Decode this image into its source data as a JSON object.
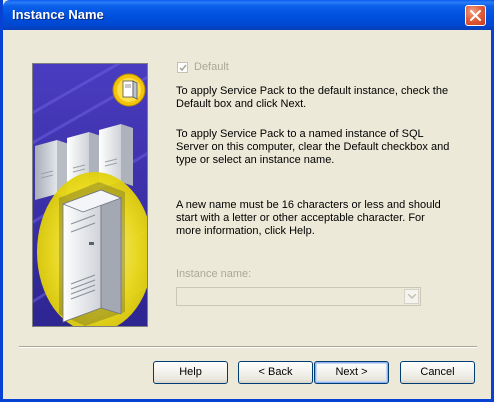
{
  "window": {
    "title": "Instance Name"
  },
  "default_checkbox": {
    "label": "Default",
    "checked": true,
    "disabled": true
  },
  "instructions": {
    "para1": "To apply Service Pack to the default instance,  check the Default box and click Next.",
    "para2": "To apply Service Pack to a named instance of SQL Server on this computer, clear the Default checkbox and type or select an instance name.",
    "para3": "A new name must be 16 characters or less and should start with a letter or other acceptable character.  For more information, click Help."
  },
  "instance_name": {
    "label": "Instance name:",
    "value": "",
    "disabled": true
  },
  "buttons": {
    "help": "Help",
    "back": "< Back",
    "next": "Next >",
    "cancel": "Cancel"
  },
  "colors": {
    "titlebar": "#0050de",
    "dialog_bg": "#ece9d8",
    "art_bg": "#3a2fa0",
    "close_button": "#e2613f"
  },
  "icons": {
    "close": "close-x-icon",
    "art": "server-cluster-illustration",
    "badge": "server-badge-icon",
    "dropdown": "chevron-down-icon"
  }
}
